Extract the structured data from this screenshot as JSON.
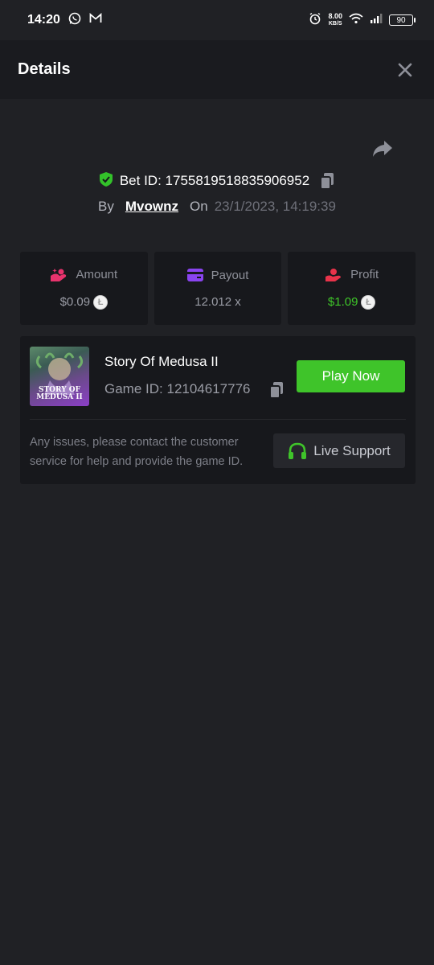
{
  "status_bar": {
    "time": "14:20",
    "net_speed": "8.00",
    "net_unit": "KB/S",
    "battery": "90"
  },
  "header": {
    "title": "Details"
  },
  "bet": {
    "bet_id_label": "Bet ID:",
    "bet_id": "1755819518835906952",
    "by_label": "By",
    "username": "Mvownz",
    "on_label": "On",
    "datetime": "23/1/2023, 14:19:39"
  },
  "stats": {
    "amount": {
      "label": "Amount",
      "value": "$0.09",
      "icon": "coins-hand-icon",
      "color": "#e8336d"
    },
    "payout": {
      "label": "Payout",
      "value": "12.012 x",
      "icon": "card-icon",
      "color": "#8a44f0"
    },
    "profit": {
      "label": "Profit",
      "value": "$1.09",
      "icon": "hand-coin-icon",
      "color": "#e8334a",
      "value_color": "#3fc629"
    },
    "currency_icon": "litecoin-icon",
    "currency_symbol": "Ł"
  },
  "game": {
    "thumb_line1": "STORY OF",
    "thumb_line2": "MEDUSA II",
    "title": "Story Of Medusa II",
    "game_id_label": "Game ID:",
    "game_id": "12104617776",
    "play_label": "Play Now",
    "support_text": "Any issues, please contact the customer service for help and provide the game ID.",
    "support_label": "Live Support"
  },
  "colors": {
    "accent_green": "#3fc42a",
    "background": "#202125",
    "card": "#17181c"
  }
}
